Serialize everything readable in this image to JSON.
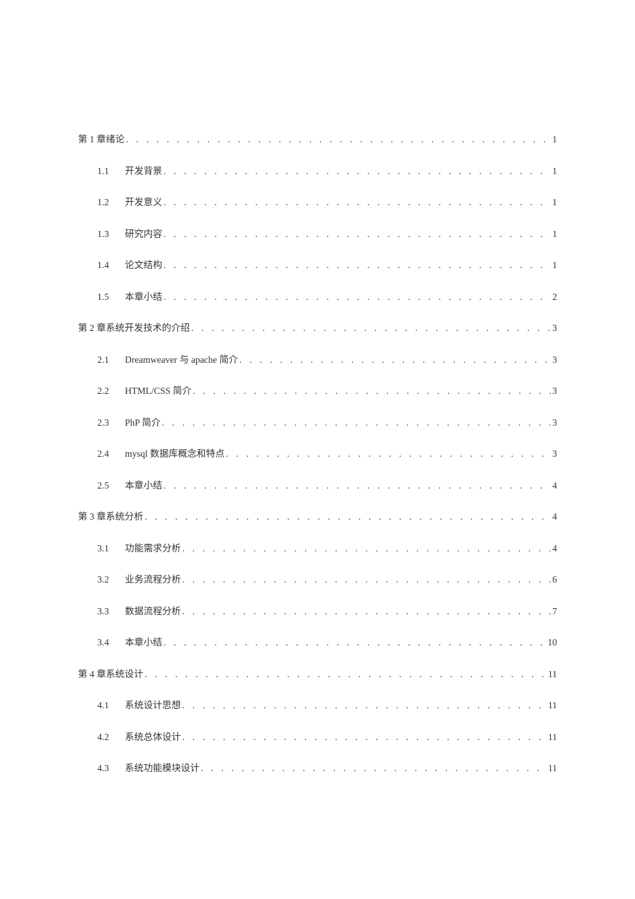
{
  "toc": [
    {
      "level": 1,
      "num": "",
      "title": "第 1 章绪论",
      "page": "1"
    },
    {
      "level": 2,
      "num": "1.1",
      "title": "开发背景",
      "page": "1"
    },
    {
      "level": 2,
      "num": "1.2",
      "title": "开发意义",
      "page": "1"
    },
    {
      "level": 2,
      "num": "1.3",
      "title": "研究内容",
      "page": "1"
    },
    {
      "level": 2,
      "num": "1.4",
      "title": "论文结构",
      "page": "1"
    },
    {
      "level": 2,
      "num": "1.5",
      "title": "本章小结",
      "page": "2"
    },
    {
      "level": 1,
      "num": "",
      "title": "第 2 章系统开发技术的介绍",
      "page": "3"
    },
    {
      "level": 2,
      "num": "2.1",
      "title": "Dreamweaver 与 apache 简介",
      "page": "3"
    },
    {
      "level": 2,
      "num": "2.2",
      "title": "HTML/CSS 简介",
      "page": "3"
    },
    {
      "level": 2,
      "num": "2.3",
      "title": "PhP 简介",
      "page": "3"
    },
    {
      "level": 2,
      "num": "2.4",
      "title": "mysql 数据库概念和特点",
      "page": "3"
    },
    {
      "level": 2,
      "num": "2.5",
      "title": "本章小结",
      "page": "4"
    },
    {
      "level": 1,
      "num": "",
      "title": "第 3 章系统分析",
      "page": "4"
    },
    {
      "level": 2,
      "num": "3.1",
      "title": "功能需求分析",
      "page": "4"
    },
    {
      "level": 2,
      "num": "3.2",
      "title": "业务流程分析",
      "page": "6"
    },
    {
      "level": 2,
      "num": "3.3",
      "title": "数据流程分析",
      "page": "7"
    },
    {
      "level": 2,
      "num": "3.4",
      "title": "本章小结",
      "page": "10"
    },
    {
      "level": 1,
      "num": "",
      "title": "第 4 章系统设计",
      "page": "11"
    },
    {
      "level": 2,
      "num": "4.1",
      "title": "系统设计思想",
      "page": "11"
    },
    {
      "level": 2,
      "num": "4.2",
      "title": "系统总体设计",
      "page": "11"
    },
    {
      "level": 2,
      "num": "4.3",
      "title": "系统功能模块设计",
      "page": "11"
    }
  ]
}
